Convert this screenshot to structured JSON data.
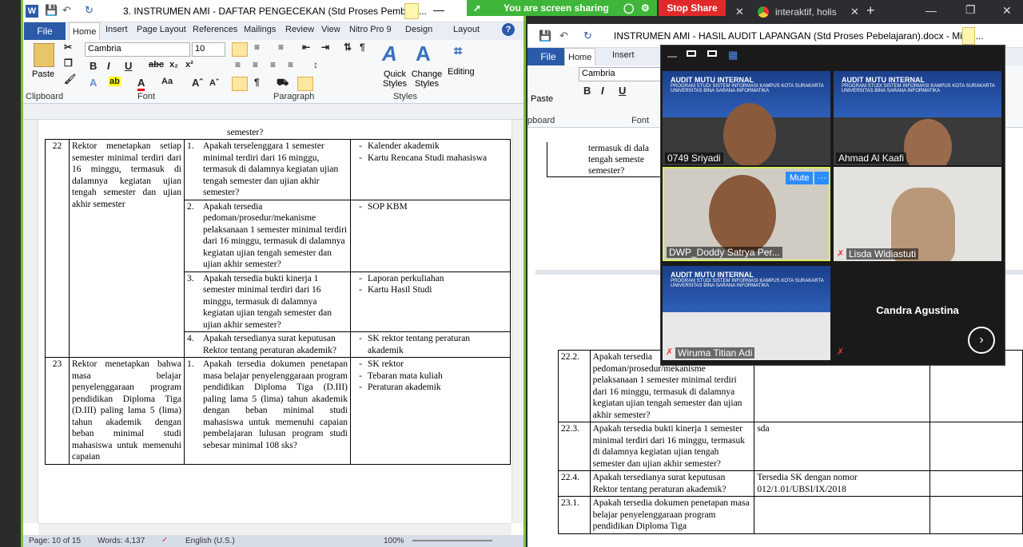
{
  "left_window": {
    "title": "3. INSTRUMEN AMI - DAFTAR PENGECEKAN (Std Proses Pembela...",
    "tabs": [
      "File",
      "Home",
      "Insert",
      "Page Layout",
      "References",
      "Mailings",
      "Review",
      "View",
      "Nitro Pro 9",
      "Design",
      "Layout"
    ],
    "font_name": "Cambria",
    "font_size": "10",
    "groups": {
      "clipboard": "Clipboard",
      "font": "Font",
      "paragraph": "Paragraph",
      "styles": "Styles"
    },
    "buttons": {
      "paste": "Paste",
      "quick_styles": "Quick Styles",
      "change_styles": "Change Styles",
      "editing": "Editing"
    },
    "top_fragment": "semester?",
    "rows": [
      {
        "no": "22",
        "desc": "Rektor menetapkan setiap semester minimal terdiri dari 16 minggu, termasuk di dalamnya kegiatan ujian tengah semester dan ujian akhir semester",
        "items": [
          {
            "n": "1.",
            "q": "Apakah terselenggara 1 semester minimal terdiri dari 16 minggu, termasuk di dalamnya kegiatan ujian tengah semester dan ujian akhir semester?",
            "ev": [
              "Kalender akademik",
              "Kartu Rencana Studi mahasiswa"
            ]
          },
          {
            "n": "2.",
            "q": "Apakah tersedia pedoman/prosedur/mekanisme pelaksanaan 1 semester minimal terdiri dari 16 minggu, termasuk di dalamnya kegiatan ujian tengah semester dan ujian akhir semester?",
            "ev": [
              "SOP KBM"
            ]
          },
          {
            "n": "3.",
            "q": "Apakah tersedia bukti kinerja 1 semester minimal terdiri dari 16 minggu, termasuk di dalamnya kegiatan ujian tengah semester dan ujian akhir semester?",
            "ev": [
              "Laporan perkuliahan",
              "Kartu Hasil Studi"
            ]
          },
          {
            "n": "4.",
            "q": "Apakah tersedianya surat keputusan Rektor tentang peraturan akademik?",
            "ev": [
              "SK rektor tentang peraturan akademik"
            ]
          }
        ]
      },
      {
        "no": "23",
        "desc": "Rektor menetapkan bahwa masa belajar penyelenggaraan program pendidikan Diploma Tiga (D.III) paling lama 5 (lima) tahun akademik dengan beban minimal studi mahasiswa untuk memenuhi capaian",
        "items": [
          {
            "n": "1.",
            "q": "Apakah tersedia dokumen penetapan masa belajar penyelenggaraan program pendidikan Diploma Tiga (D.III) paling lama 5 (lima) tahun akademik dengan beban minimal studi mahasiswa untuk memenuhi capaian pembelajaran lulusan program studi sebesar minimal 108 sks?",
            "ev": [
              "SK rektor",
              "Tebaran mata kuliah",
              "Peraturan akademik"
            ]
          }
        ]
      }
    ],
    "status": {
      "page": "Page: 10 of 15",
      "words": "Words: 4,137",
      "lang": "English (U.S.)",
      "zoom": "100%"
    }
  },
  "right_window": {
    "title": "INSTRUMEN AMI - HASIL AUDIT LAPANGAN (Std Proses Pebelajaran).docx - Micro...",
    "tabs": [
      "File",
      "Home",
      "Insert"
    ],
    "font_name": "Cambria",
    "paste": "Paste",
    "group_clipboard": "pboard",
    "group_font": "Font",
    "top_text": [
      "termasuk di dala",
      "tengah semeste",
      "semester?"
    ],
    "rows": [
      {
        "no": "22.2.",
        "q": "Apakah tersedia pedoman/prosedur/mekanisme pelaksanaan 1 semester minimal terdiri dari 16 minggu, termasuk di dalamnya kegiatan ujian tengah semester dan ujian akhir semester?",
        "a": ""
      },
      {
        "no": "22.3.",
        "q": "Apakah tersedia bukti kinerja 1 semester minimal terdiri dari 16 minggu, termasuk di dalamnya kegiatan ujian tengah semester dan ujian akhir semester?",
        "a": "sda"
      },
      {
        "no": "22.4.",
        "q": "Apakah tersedianya surat keputusan Rektor tentang peraturan akademik?",
        "a": "Tersedia SK dengan nomor 012/1.01/UBSI/IX/2018"
      },
      {
        "no": "23.1.",
        "q": "Apakah tersedia dokumen penetapan masa belajar penyelenggaraan program pendidikan Diploma Tiga",
        "a": ""
      }
    ]
  },
  "screen_share": {
    "sharing": "You are screen sharing",
    "stop": "Stop Share"
  },
  "browser_tab": "interaktif, holis",
  "zoom_gallery": {
    "banner_title": "AUDIT MUTU INTERNAL",
    "banner_sub": "PROGRAM STUDI SISTEM INFORMASI KAMPUS KOTA SURAKARTA UNIVERSITAS BINA SARANA INFORMATIKA",
    "participants": [
      "0749 Sriyadi",
      "Ahmad Al Kaafi",
      "DWP_Doddy Satrya Per...",
      "Lisda Widiastuti",
      "Wiruma Titian Adi",
      "Candra Agustina"
    ],
    "mute": "Mute",
    "more": "···"
  },
  "colors": {
    "accent": "#2a5aa8",
    "share_green": "#3fb63a",
    "stop_red": "#e02a2a",
    "zoom_bg": "#1a1a1a"
  }
}
